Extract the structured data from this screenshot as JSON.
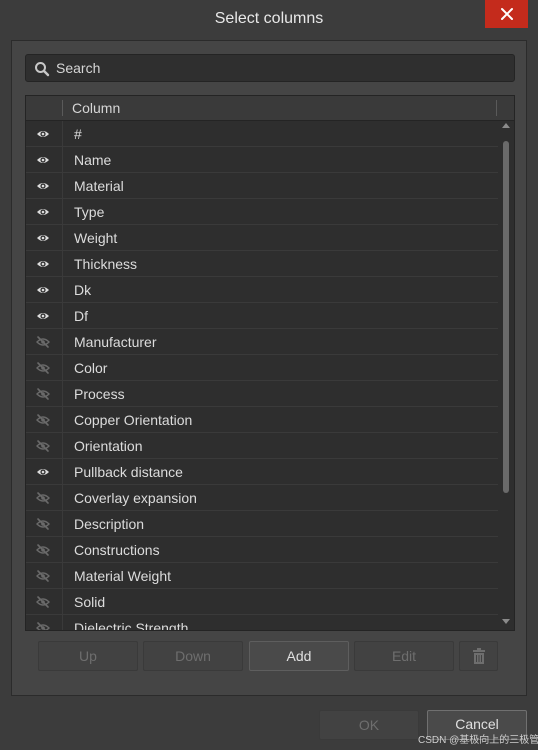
{
  "dialog": {
    "title": "Select columns",
    "close_icon": "close-icon"
  },
  "search": {
    "placeholder": "Search",
    "icon": "search-icon"
  },
  "grid": {
    "header": "Column",
    "rows": [
      {
        "label": "#",
        "visible": true
      },
      {
        "label": "Name",
        "visible": true
      },
      {
        "label": "Material",
        "visible": true
      },
      {
        "label": "Type",
        "visible": true
      },
      {
        "label": "Weight",
        "visible": true
      },
      {
        "label": "Thickness",
        "visible": true
      },
      {
        "label": "Dk",
        "visible": true
      },
      {
        "label": "Df",
        "visible": true
      },
      {
        "label": "Manufacturer",
        "visible": false
      },
      {
        "label": "Color",
        "visible": false
      },
      {
        "label": "Process",
        "visible": false
      },
      {
        "label": "Copper Orientation",
        "visible": false
      },
      {
        "label": "Orientation",
        "visible": false
      },
      {
        "label": "Pullback distance",
        "visible": true
      },
      {
        "label": "Coverlay expansion",
        "visible": false
      },
      {
        "label": "Description",
        "visible": false
      },
      {
        "label": "Constructions",
        "visible": false
      },
      {
        "label": "Material Weight",
        "visible": false
      },
      {
        "label": "Solid",
        "visible": false
      },
      {
        "label": "Dielectric Strength",
        "visible": false
      }
    ]
  },
  "buttons": {
    "up": "Up",
    "down": "Down",
    "add": "Add",
    "edit": "Edit",
    "delete_icon": "trash-icon",
    "ok": "OK",
    "cancel": "Cancel"
  },
  "watermark": "CSDN @基极向上的三极管",
  "colors": {
    "close_button": "#c42b1c",
    "background": "#3c3c3c",
    "panel": "#454545",
    "grid": "#2e2e2e"
  }
}
